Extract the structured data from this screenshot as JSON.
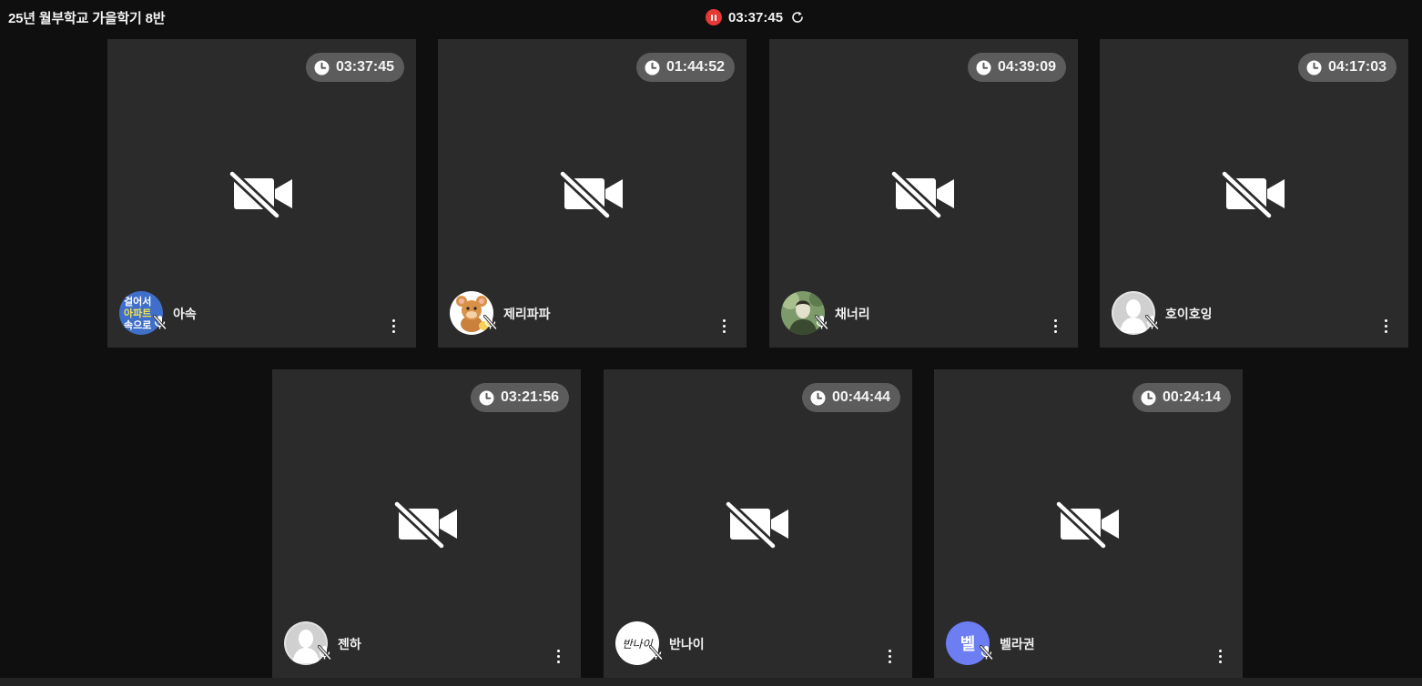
{
  "room": {
    "title": "25년 월부학교 가을학기 8반"
  },
  "session": {
    "elapsed": "03:37:45"
  },
  "participants": [
    {
      "name": "아속",
      "timer": "03:37:45",
      "avatar_lines": [
        "걸어서",
        "아파트",
        "속으로"
      ]
    },
    {
      "name": "제리파파",
      "timer": "01:44:52"
    },
    {
      "name": "채너리",
      "timer": "04:39:09"
    },
    {
      "name": "호이호잉",
      "timer": "04:17:03"
    },
    {
      "name": "젠하",
      "timer": "03:21:56"
    },
    {
      "name": "반나이",
      "timer": "00:44:44",
      "avatar_text": "반나이"
    },
    {
      "name": "벨라권",
      "timer": "00:24:14",
      "avatar_text": "벨"
    }
  ],
  "colors": {
    "background": "#0f0f0f",
    "tile": "#2b2b2b",
    "timer_pill": "#5c5c5c",
    "record_accent": "#e53935",
    "initial_avatar": "#6c7ef2"
  },
  "icons": {
    "camera_status": "video-off-icon",
    "microphone_status": "mic-off-icon",
    "timer": "clock-icon",
    "participant_menu": "more-vertical-icon",
    "session_record": "pause-icon",
    "session_refresh": "refresh-icon"
  }
}
